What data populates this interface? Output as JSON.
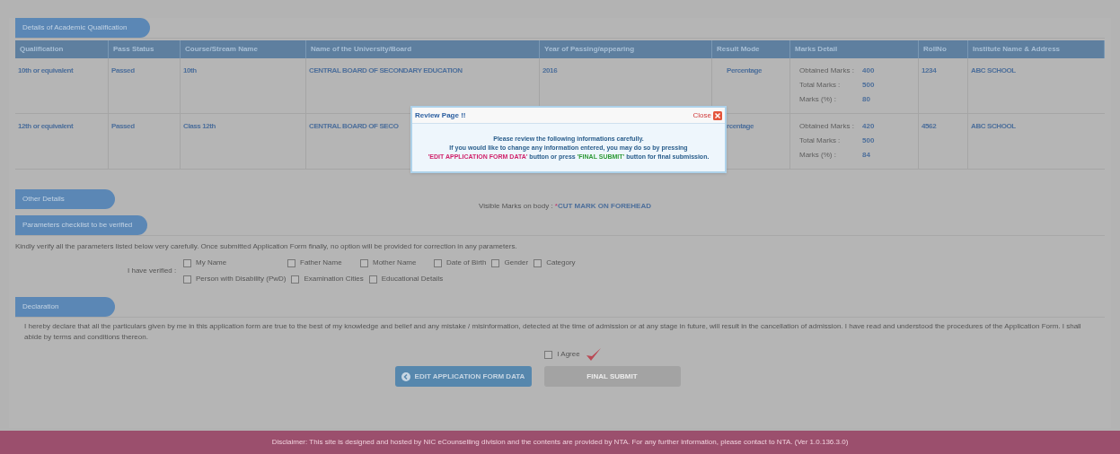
{
  "academic": {
    "heading": "Details of Academic Qualification",
    "columns": [
      "Qualification",
      "Pass Status",
      "Course/Stream Name",
      "Name of the University/Board",
      "Year of Passing/appearing",
      "Result Mode",
      "Marks Detail",
      "RollNo",
      "Institute Name & Address"
    ],
    "rows": [
      {
        "qualification": "10th or equivalent",
        "status": "Passed",
        "course": "10th",
        "board": "CENTRAL BOARD OF SECONDARY EDUCATION",
        "year": "2016",
        "mode": "Percentage",
        "marks": [
          {
            "label": "Obtained Marks :",
            "value": "400"
          },
          {
            "label": "Total Marks :",
            "value": "500"
          },
          {
            "label": "Marks (%) :",
            "value": "80"
          }
        ],
        "roll": "1234",
        "institute": "ABC SCHOOL"
      },
      {
        "qualification": "12th or equivalent",
        "status": "Passed",
        "course": "Class 12th",
        "board": "CENTRAL BOARD OF SECO",
        "mode": "rcentage",
        "marks": [
          {
            "label": "Obtained Marks :",
            "value": "420"
          },
          {
            "label": "Total Marks :",
            "value": "500"
          },
          {
            "label": "Marks (%) :",
            "value": "84"
          }
        ],
        "roll": "4562",
        "institute": "ABC SCHOOL"
      }
    ]
  },
  "other": {
    "heading": "Other Details",
    "label": "Visible Marks on body :",
    "required_mark": "*",
    "value": "CUT MARK ON FOREHEAD"
  },
  "checklist": {
    "heading": "Parameters checklist to be verified",
    "note": "Kindly verify all the parameters listed below very carefully. Once submitted Application Form finally, no option will be provided for correction in any parameters.",
    "label": "I have verified :",
    "rows": [
      [
        {
          "label": "My Name",
          "checked": false
        },
        {
          "label": "Father Name",
          "checked": false
        },
        {
          "label": "Mother Name",
          "checked": false
        },
        {
          "label": "Date of Birth",
          "checked": false
        },
        {
          "label": "Gender",
          "checked": false
        },
        {
          "label": "Category",
          "checked": false
        }
      ],
      [
        {
          "label": "Person with Disability (PwD)",
          "checked": false
        },
        {
          "label": "Examination Cities",
          "checked": false
        },
        {
          "label": "Educational Details",
          "checked": false
        }
      ]
    ]
  },
  "declaration": {
    "heading": "Declaration",
    "text": "I hereby declare that all the particulars given by me in this application form are true to the best of my knowledge and belief and any mistake / misinformation, detected at the time of admission or at any stage in future, will result in the cancellation of admission. I have read and understood the procedures of the Application Form. I shall abide by terms and conditions thereon.",
    "agree": {
      "label": "I Agree",
      "checked": false
    }
  },
  "buttons": [
    {
      "label": "EDIT APPLICATION FORM DATA",
      "kind": "edit",
      "disabled": false
    },
    {
      "label": "FINAL SUBMIT",
      "kind": "submit",
      "disabled": true
    }
  ],
  "modal": {
    "title": "Review Page !!",
    "close": "Close",
    "line1": "Please review the following informations carefully.",
    "line2": "If you would like to change any information entered, you may do so by pressing",
    "line3": "'EDIT APPLICATION FORM DATA'",
    "line4": " button or press ",
    "line5": "'FINAL SUBMIT'",
    "line6": " button for final submission."
  },
  "footer": "Disclaimer: This site is designed and hosted by NIC eCounselling division and the contents are provided by NTA. For any further information, please contact to NTA. (Ver 1.0.136.3.0)"
}
